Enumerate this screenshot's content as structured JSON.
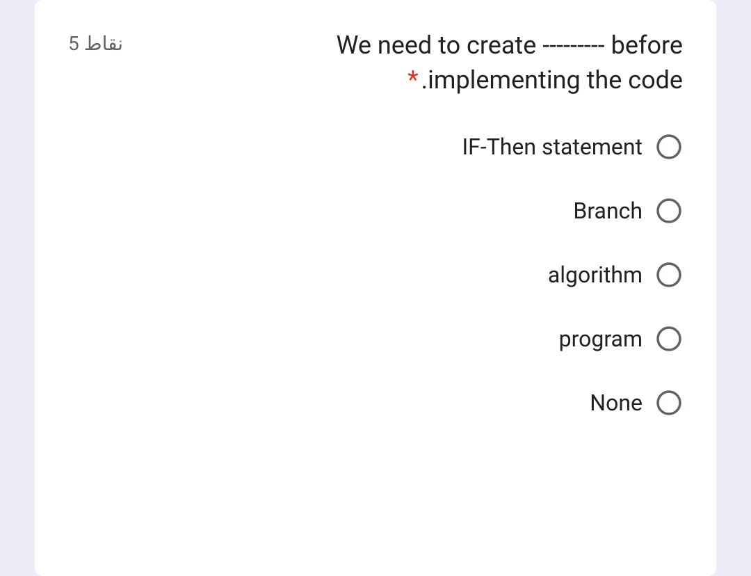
{
  "question": {
    "points": "5 نقاط",
    "line1": "We need to create --------- before",
    "line2": ".implementing the code",
    "required_marker": "*"
  },
  "options": [
    {
      "label": "IF-Then statement"
    },
    {
      "label": "Branch"
    },
    {
      "label": "algorithm"
    },
    {
      "label": "program"
    },
    {
      "label": "None"
    }
  ]
}
